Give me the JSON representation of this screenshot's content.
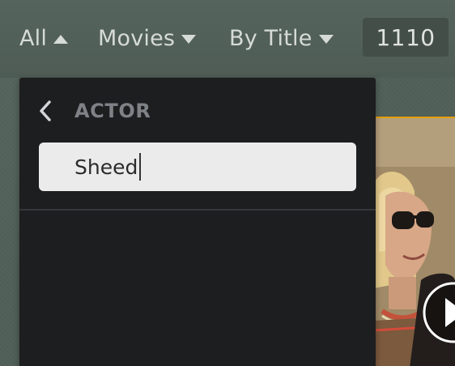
{
  "filters": {
    "scope": {
      "label": "All",
      "arrow": "up"
    },
    "library": {
      "label": "Movies",
      "arrow": "down"
    },
    "sort": {
      "label": "By Title",
      "arrow": "down"
    }
  },
  "count": "1110",
  "dropdown": {
    "title": "ACTOR",
    "back_icon": "chevron-left-icon",
    "search": {
      "value": "Sheed",
      "placeholder": ""
    }
  },
  "colors": {
    "accent": "#e5a00d",
    "panel_bg": "#1d1e20",
    "topbar_text": "#d6dbd8"
  }
}
